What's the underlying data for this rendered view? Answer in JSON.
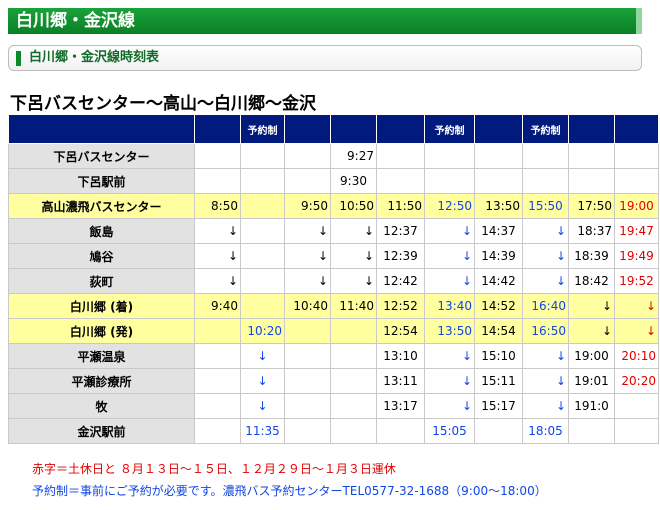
{
  "header": {
    "title": "白川郷・金沢線"
  },
  "subheader": {
    "title": "白川郷・金沢線時刻表"
  },
  "route_title": "下呂バスセンター〜高山〜白川郷〜金沢",
  "table": {
    "header": [
      "",
      "",
      "予約制",
      "",
      "",
      "",
      "予約制",
      "",
      "予約制",
      "",
      ""
    ],
    "rows": [
      {
        "stop": "下呂バスセンター",
        "hl": false,
        "cells": [
          {
            "t": "",
            "c": "",
            "a": ""
          },
          {
            "t": "",
            "c": "",
            "a": ""
          },
          {
            "t": "",
            "c": "",
            "a": ""
          },
          {
            "t": "9:27",
            "c": "",
            "a": "r"
          },
          {
            "t": "",
            "c": "",
            "a": ""
          },
          {
            "t": "",
            "c": "",
            "a": ""
          },
          {
            "t": "",
            "c": "",
            "a": ""
          },
          {
            "t": "",
            "c": "",
            "a": ""
          },
          {
            "t": "",
            "c": "",
            "a": ""
          },
          {
            "t": "",
            "c": "",
            "a": ""
          }
        ]
      },
      {
        "stop": "下呂駅前",
        "hl": false,
        "cells": [
          {
            "t": "",
            "c": "",
            "a": ""
          },
          {
            "t": "",
            "c": "",
            "a": ""
          },
          {
            "t": "",
            "c": "",
            "a": ""
          },
          {
            "t": "9:30",
            "c": "",
            "a": "c"
          },
          {
            "t": "",
            "c": "",
            "a": ""
          },
          {
            "t": "",
            "c": "",
            "a": ""
          },
          {
            "t": "",
            "c": "",
            "a": ""
          },
          {
            "t": "",
            "c": "",
            "a": ""
          },
          {
            "t": "",
            "c": "",
            "a": ""
          },
          {
            "t": "",
            "c": "",
            "a": ""
          }
        ]
      },
      {
        "stop": "高山濃飛バスセンター",
        "hl": true,
        "cells": [
          {
            "t": "8:50",
            "c": "",
            "a": "r"
          },
          {
            "t": "",
            "c": "",
            "a": ""
          },
          {
            "t": "9:50",
            "c": "",
            "a": "r"
          },
          {
            "t": "10:50",
            "c": "",
            "a": "r"
          },
          {
            "t": "11:50",
            "c": "",
            "a": "r"
          },
          {
            "t": "12:50",
            "c": "blue",
            "a": "r"
          },
          {
            "t": "13:50",
            "c": "",
            "a": "r"
          },
          {
            "t": "15:50",
            "c": "blue",
            "a": "c"
          },
          {
            "t": "17:50",
            "c": "",
            "a": "r"
          },
          {
            "t": "19:00",
            "c": "red",
            "a": "c"
          }
        ]
      },
      {
        "stop": "飯島",
        "hl": false,
        "cells": [
          {
            "t": "↓",
            "c": "",
            "a": "r"
          },
          {
            "t": "",
            "c": "",
            "a": ""
          },
          {
            "t": "↓",
            "c": "",
            "a": "r"
          },
          {
            "t": "↓",
            "c": "",
            "a": "r"
          },
          {
            "t": "12:37",
            "c": "",
            "a": "c"
          },
          {
            "t": "↓",
            "c": "blue",
            "a": "r"
          },
          {
            "t": "14:37",
            "c": "",
            "a": "c"
          },
          {
            "t": "↓",
            "c": "blue",
            "a": "r"
          },
          {
            "t": "18:37",
            "c": "",
            "a": "r"
          },
          {
            "t": "19:47",
            "c": "red",
            "a": "c"
          }
        ]
      },
      {
        "stop": "鳩谷",
        "hl": false,
        "cells": [
          {
            "t": "↓",
            "c": "",
            "a": "r"
          },
          {
            "t": "",
            "c": "",
            "a": ""
          },
          {
            "t": "↓",
            "c": "",
            "a": "r"
          },
          {
            "t": "↓",
            "c": "",
            "a": "r"
          },
          {
            "t": "12:39",
            "c": "",
            "a": "c"
          },
          {
            "t": "↓",
            "c": "blue",
            "a": "r"
          },
          {
            "t": "14:39",
            "c": "",
            "a": "c"
          },
          {
            "t": "↓",
            "c": "blue",
            "a": "r"
          },
          {
            "t": "18:39",
            "c": "",
            "a": "c"
          },
          {
            "t": "19:49",
            "c": "red",
            "a": "c"
          }
        ]
      },
      {
        "stop": "荻町",
        "hl": false,
        "cells": [
          {
            "t": "↓",
            "c": "",
            "a": "r"
          },
          {
            "t": "",
            "c": "",
            "a": ""
          },
          {
            "t": "↓",
            "c": "",
            "a": "r"
          },
          {
            "t": "↓",
            "c": "",
            "a": "r"
          },
          {
            "t": "12:42",
            "c": "",
            "a": "c"
          },
          {
            "t": "↓",
            "c": "blue",
            "a": "r"
          },
          {
            "t": "14:42",
            "c": "",
            "a": "c"
          },
          {
            "t": "↓",
            "c": "blue",
            "a": "r"
          },
          {
            "t": "18:42",
            "c": "",
            "a": "c"
          },
          {
            "t": "19:52",
            "c": "red",
            "a": "c"
          }
        ]
      },
      {
        "stop": "白川郷 (着)",
        "hl": true,
        "cells": [
          {
            "t": "9:40",
            "c": "",
            "a": "r"
          },
          {
            "t": "",
            "c": "",
            "a": ""
          },
          {
            "t": "10:40",
            "c": "",
            "a": "r"
          },
          {
            "t": "11:40",
            "c": "",
            "a": "r"
          },
          {
            "t": "12:52",
            "c": "",
            "a": "c"
          },
          {
            "t": "13:40",
            "c": "blue",
            "a": "r"
          },
          {
            "t": "14:52",
            "c": "",
            "a": "c"
          },
          {
            "t": "16:40",
            "c": "blue",
            "a": "r"
          },
          {
            "t": "↓",
            "c": "",
            "a": "r"
          },
          {
            "t": "↓",
            "c": "red",
            "a": "r"
          }
        ]
      },
      {
        "stop": "白川郷 (発)",
        "hl": true,
        "cells": [
          {
            "t": "",
            "c": "",
            "a": ""
          },
          {
            "t": "10:20",
            "c": "blue",
            "a": "r"
          },
          {
            "t": "",
            "c": "",
            "a": ""
          },
          {
            "t": "",
            "c": "",
            "a": ""
          },
          {
            "t": "12:54",
            "c": "",
            "a": "c"
          },
          {
            "t": "13:50",
            "c": "blue",
            "a": "r"
          },
          {
            "t": "14:54",
            "c": "",
            "a": "c"
          },
          {
            "t": "16:50",
            "c": "blue",
            "a": "r"
          },
          {
            "t": "↓",
            "c": "",
            "a": "r"
          },
          {
            "t": "↓",
            "c": "red",
            "a": "r"
          }
        ]
      },
      {
        "stop": "平瀬温泉",
        "hl": false,
        "cells": [
          {
            "t": "",
            "c": "",
            "a": ""
          },
          {
            "t": "↓",
            "c": "blue",
            "a": "c"
          },
          {
            "t": "",
            "c": "",
            "a": ""
          },
          {
            "t": "",
            "c": "",
            "a": ""
          },
          {
            "t": "13:10",
            "c": "",
            "a": "c"
          },
          {
            "t": "↓",
            "c": "blue",
            "a": "r"
          },
          {
            "t": "15:10",
            "c": "",
            "a": "c"
          },
          {
            "t": "↓",
            "c": "blue",
            "a": "r"
          },
          {
            "t": "19:00",
            "c": "",
            "a": "c"
          },
          {
            "t": "20:10",
            "c": "red",
            "a": "r"
          }
        ]
      },
      {
        "stop": "平瀬診療所",
        "hl": false,
        "cells": [
          {
            "t": "",
            "c": "",
            "a": ""
          },
          {
            "t": "↓",
            "c": "blue",
            "a": "c"
          },
          {
            "t": "",
            "c": "",
            "a": ""
          },
          {
            "t": "",
            "c": "",
            "a": ""
          },
          {
            "t": "13:11",
            "c": "",
            "a": "c"
          },
          {
            "t": "↓",
            "c": "blue",
            "a": "r"
          },
          {
            "t": "15:11",
            "c": "",
            "a": "c"
          },
          {
            "t": "↓",
            "c": "blue",
            "a": "r"
          },
          {
            "t": "19:01",
            "c": "",
            "a": "c"
          },
          {
            "t": "20:20",
            "c": "red",
            "a": "r"
          }
        ]
      },
      {
        "stop": "牧",
        "hl": false,
        "cells": [
          {
            "t": "",
            "c": "",
            "a": ""
          },
          {
            "t": "↓",
            "c": "blue",
            "a": "c"
          },
          {
            "t": "",
            "c": "",
            "a": ""
          },
          {
            "t": "",
            "c": "",
            "a": ""
          },
          {
            "t": "13:17",
            "c": "",
            "a": "c"
          },
          {
            "t": "↓",
            "c": "blue",
            "a": "r"
          },
          {
            "t": "15:17",
            "c": "",
            "a": "c"
          },
          {
            "t": "↓",
            "c": "blue",
            "a": "r"
          },
          {
            "t": "191:0",
            "c": "",
            "a": "c"
          },
          {
            "t": "",
            "c": "",
            "a": ""
          }
        ]
      },
      {
        "stop": "金沢駅前",
        "hl": false,
        "cells": [
          {
            "t": "",
            "c": "",
            "a": ""
          },
          {
            "t": "11:35",
            "c": "blue",
            "a": "c"
          },
          {
            "t": "",
            "c": "",
            "a": ""
          },
          {
            "t": "",
            "c": "",
            "a": ""
          },
          {
            "t": "",
            "c": "",
            "a": ""
          },
          {
            "t": "15:05",
            "c": "blue",
            "a": "c"
          },
          {
            "t": "",
            "c": "",
            "a": ""
          },
          {
            "t": "18:05",
            "c": "blue",
            "a": "c"
          },
          {
            "t": "",
            "c": "",
            "a": ""
          },
          {
            "t": "",
            "c": "",
            "a": ""
          }
        ]
      }
    ]
  },
  "notes": {
    "holiday": "赤字＝土休日と ８月１３日〜１５日、１２月２９日〜１月３日運休",
    "reservation": "予約制＝事前にご予約が必要です。濃飛バス予約センターTEL0577-32-1688（9:00〜18:00）"
  },
  "colors": {
    "header_green": "#0b8a2a",
    "table_header": "#001b7d",
    "highlight": "#ffff9f",
    "blue": "#1046e6",
    "red": "#e30000"
  }
}
